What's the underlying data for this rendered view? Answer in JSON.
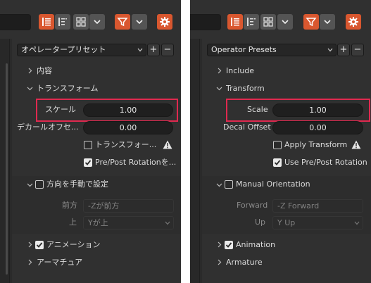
{
  "colors": {
    "accent": "#d9572f",
    "highlight": "#e0294f",
    "panel_bg": "#2a2a2a"
  },
  "toolbar": {
    "icons": [
      "list-view-icon",
      "list-detail-icon",
      "grid-view-icon",
      "chevron-down-icon",
      "filter-icon",
      "chevron-down-icon",
      "gear-icon"
    ]
  },
  "left": {
    "preset_dropdown": "オペレータープリセット",
    "add": "+",
    "remove": "−",
    "include": "内容",
    "transform": "トランスフォーム",
    "scale_label": "スケール",
    "scale_value": "1.00",
    "decal_label": "デカールオフセ...",
    "decal_value": "0.00",
    "apply_transform": "トランスフォー...",
    "prepost": "Pre/Post Rotationを...",
    "manual_orientation": "方向を手動で設定",
    "forward_label": "前方",
    "forward_value": "-Zが前方",
    "up_label": "上",
    "up_value": "Yが上",
    "animation": "アニメーション",
    "armature": "アーマチュア"
  },
  "right": {
    "preset_dropdown": "Operator Presets",
    "add": "+",
    "remove": "−",
    "include": "Include",
    "transform": "Transform",
    "scale_label": "Scale",
    "scale_value": "1.00",
    "decal_label": "Decal Offset",
    "decal_value": "0.00",
    "apply_transform": "Apply Transform",
    "prepost": "Use Pre/Post Rotation",
    "manual_orientation": "Manual Orientation",
    "forward_label": "Forward",
    "forward_value": "-Z Forward",
    "up_label": "Up",
    "up_value": "Y Up",
    "animation": "Animation",
    "armature": "Armature"
  }
}
